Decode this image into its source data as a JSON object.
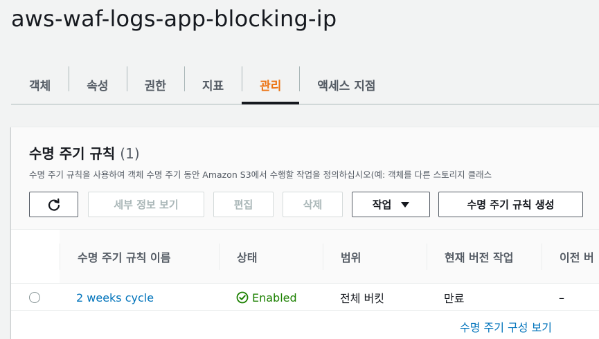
{
  "bucket_name": "aws-waf-logs-app-blocking-ip",
  "tabs": [
    {
      "label": "객체"
    },
    {
      "label": "속성"
    },
    {
      "label": "권한"
    },
    {
      "label": "지표"
    },
    {
      "label": "관리",
      "active": true
    },
    {
      "label": "액세스 지점"
    }
  ],
  "lifecycle": {
    "title": "수명 주기 규칙",
    "count": "(1)",
    "description": "수명 주기 규칙을 사용하여 객체 수명 주기 동안 Amazon S3에서 수행할 작업을 정의하십시오(예: 객체를 다른 스토리지 클래스",
    "buttons": {
      "refresh_icon": "refresh-icon",
      "view_details": "세부 정보 보기",
      "edit": "편집",
      "delete": "삭제",
      "actions": "작업",
      "create": "수명 주기 규칙 생성"
    },
    "columns": [
      "수명 주기 규칙 이름",
      "상태",
      "범위",
      "현재 버전 작업",
      "이전 버"
    ],
    "rows": [
      {
        "name": "2 weeks cycle",
        "status": "Enabled",
        "scope": "전체 버킷",
        "current_version_action": "만료",
        "previous_version_action": "–"
      }
    ],
    "view_config_link": "수명 주기 구성 보기"
  },
  "colors": {
    "accent": "#ec7211",
    "link": "#0073bb",
    "success": "#1d8102"
  }
}
